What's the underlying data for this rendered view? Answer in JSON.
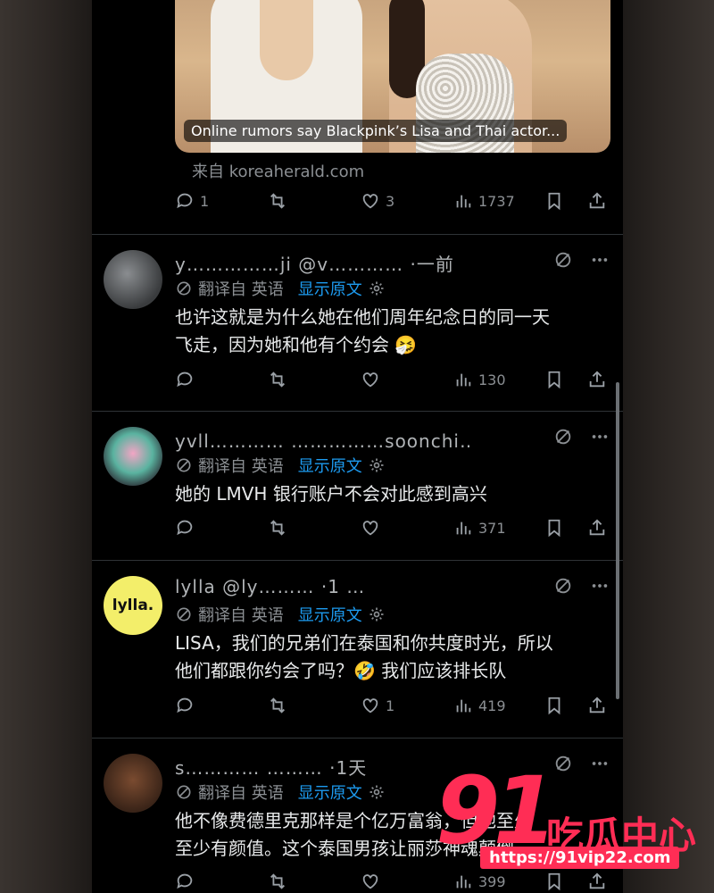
{
  "card": {
    "image_caption": "Online rumors say Blackpink’s Lisa and Thai actor...",
    "source": "来自 koreaherald.com",
    "replies": "1",
    "reposts": "",
    "likes": "3",
    "views": "1737"
  },
  "replies": [
    {
      "handle": "y……………ji @v………… ·一前",
      "translate_label": "翻译自 英语",
      "show_original": "显示原文",
      "text_line1": "也许这就是为什么她在他们周年纪念日的同一天",
      "text_line2": "飞走，因为她和他有个约会 🤧",
      "replies": "",
      "likes": "",
      "views": "130"
    },
    {
      "handle": "yvll………… ……………soonchi……·1天",
      "translate_label": "翻译自 英语",
      "show_original": "显示原文",
      "text_line1": "她的 LMVH 银行账户不会对此感到高兴",
      "text_line2": "",
      "replies": "",
      "likes": "",
      "views": "371"
    },
    {
      "handle": "lylla @ly……… ·1 …",
      "translate_label": "翻译自 英语",
      "show_original": "显示原文",
      "text_line1": "LISA，我们的兄弟们在泰国和你共度时光，所以",
      "text_line2": "他们都跟你约会了吗？🤣 我们应该排长队",
      "replies": "",
      "likes": "1",
      "views": "419"
    },
    {
      "handle": "s………… ……… ·1天",
      "translate_label": "翻译自 英语",
      "show_original": "显示原文",
      "text_line1": "他不像费德里克那样是个亿万富翁，但他至少",
      "text_line2": "至少有颜值。这个泰国男孩让丽莎神魂颠倒",
      "replies": "",
      "likes": "",
      "views": "399"
    }
  ],
  "avatar_lylla_text": "lylla.",
  "watermark": {
    "number": "91",
    "name": "吃瓜中心",
    "url": "https://91vip22.com"
  },
  "colors": {
    "background": "#000000",
    "link": "#1d9bf0",
    "muted": "#8b8f93",
    "watermark": "#ff2d55"
  }
}
